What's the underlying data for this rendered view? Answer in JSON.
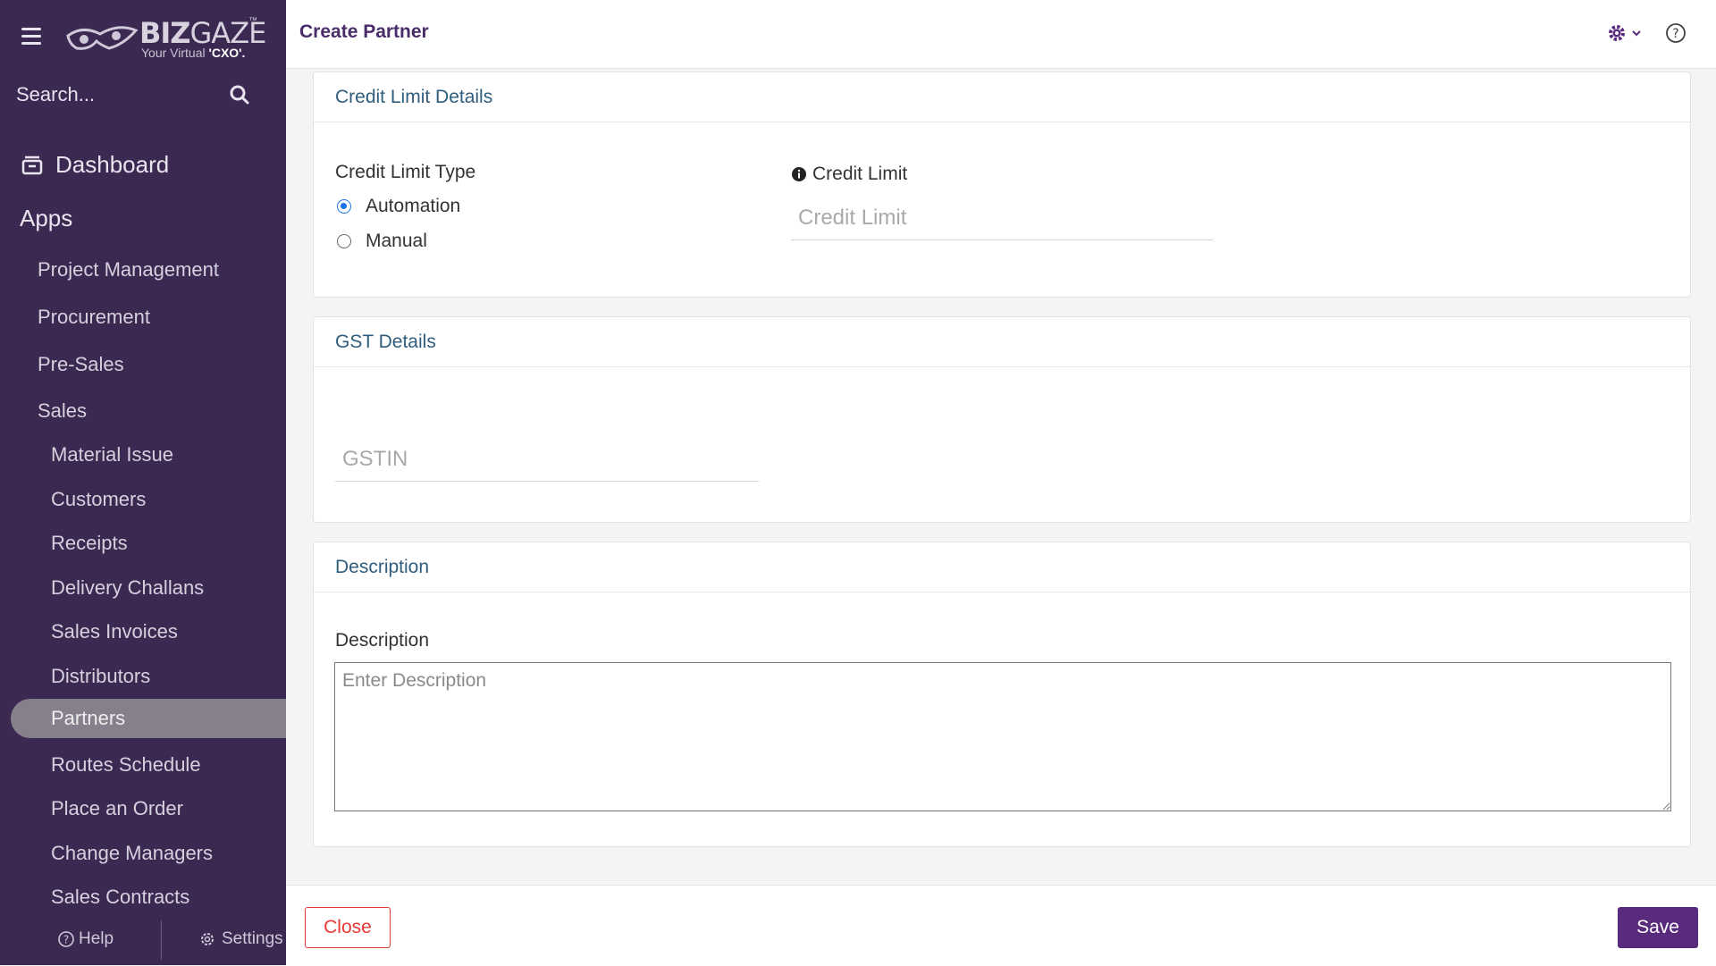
{
  "brand": {
    "name_bold": "BIZ",
    "name_thin": "GAZE",
    "trademark": "™",
    "tagline_prefix": "Your Virtual ",
    "tagline_bold": "'CXO'."
  },
  "sidebar": {
    "search_placeholder": "Search...",
    "dashboard_label": "Dashboard",
    "apps_label": "Apps",
    "items": [
      {
        "label": "Project Management",
        "level": 1
      },
      {
        "label": "Procurement",
        "level": 1
      },
      {
        "label": "Pre-Sales",
        "level": 1
      },
      {
        "label": "Sales",
        "level": 1
      },
      {
        "label": "Material Issue",
        "level": 2
      },
      {
        "label": "Customers",
        "level": 2
      },
      {
        "label": "Receipts",
        "level": 2
      },
      {
        "label": "Delivery Challans",
        "level": 2
      },
      {
        "label": "Sales Invoices",
        "level": 2
      },
      {
        "label": "Distributors",
        "level": 2
      },
      {
        "label": "Partners",
        "level": 2,
        "active": true
      },
      {
        "label": "Routes Schedule",
        "level": 2
      },
      {
        "label": "Place an Order",
        "level": 2
      },
      {
        "label": "Change Managers",
        "level": 2
      },
      {
        "label": "Sales Contracts",
        "level": 2
      }
    ],
    "help_label": "Help",
    "settings_label": "Settings"
  },
  "header": {
    "title": "Create Partner"
  },
  "credit_section": {
    "title": "Credit Limit Details",
    "type_label": "Credit Limit Type",
    "options": [
      {
        "label": "Automation",
        "checked": true
      },
      {
        "label": "Manual",
        "checked": false
      }
    ],
    "limit_label": "Credit Limit",
    "limit_placeholder": "Credit Limit",
    "limit_value": ""
  },
  "gst_section": {
    "title": "GST Details",
    "gstin_placeholder": "GSTIN",
    "gstin_value": ""
  },
  "description_section": {
    "title": "Description",
    "field_label": "Description",
    "placeholder": "Enter Description",
    "value": ""
  },
  "footer": {
    "close_label": "Close",
    "save_label": "Save"
  },
  "colors": {
    "sidebar_bg": "#3c2952",
    "accent": "#5a2a7c",
    "close_red": "#e53935",
    "section_title": "#2f5d7e",
    "radio_blue": "#1a73e8"
  }
}
